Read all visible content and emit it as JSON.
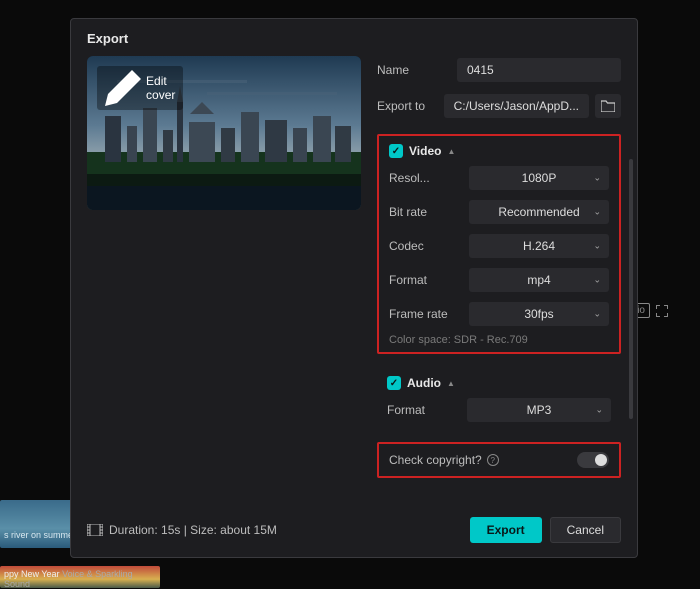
{
  "bg": {
    "thumb1": "s river on summer",
    "thumb2_a": "ppy New Year",
    "thumb2_b": "Voice & Sparkling Sound",
    "ratio": "Ratio"
  },
  "dialog": {
    "title": "Export",
    "edit_cover": "Edit cover",
    "name_label": "Name",
    "name_value": "0415",
    "export_to_label": "Export to",
    "export_to_value": "C:/Users/Jason/AppD...",
    "video": {
      "title": "Video",
      "resolution_label": "Resol...",
      "resolution_value": "1080P",
      "bitrate_label": "Bit rate",
      "bitrate_value": "Recommended",
      "codec_label": "Codec",
      "codec_value": "H.264",
      "format_label": "Format",
      "format_value": "mp4",
      "framerate_label": "Frame rate",
      "framerate_value": "30fps",
      "colorspace": "Color space: SDR - Rec.709"
    },
    "audio": {
      "title": "Audio",
      "format_label": "Format",
      "format_value": "MP3"
    },
    "check_copyright_label": "Check copyright?",
    "footer_info": "Duration: 15s | Size: about 15M",
    "export_btn": "Export",
    "cancel_btn": "Cancel"
  }
}
